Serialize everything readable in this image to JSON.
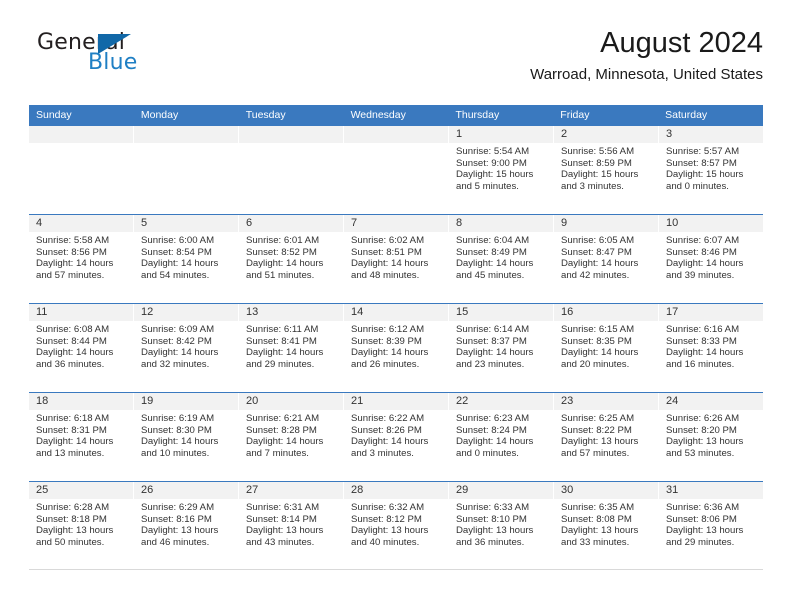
{
  "brand": {
    "name_part1": "General",
    "name_part2": "Blue",
    "triangle_color": "#1168a8",
    "blue_text_color": "#1f7fc4"
  },
  "header": {
    "month_title": "August 2024",
    "location": "Warroad, Minnesota, United States"
  },
  "theme": {
    "header_blue": "#3a79bf",
    "day_band_gray": "#f2f2f2",
    "text_color": "#333333"
  },
  "weekdays": [
    "Sunday",
    "Monday",
    "Tuesday",
    "Wednesday",
    "Thursday",
    "Friday",
    "Saturday"
  ],
  "weeks": [
    [
      {
        "day": "",
        "sunrise": "",
        "sunset": "",
        "daylight_line1": "",
        "daylight_line2": ""
      },
      {
        "day": "",
        "sunrise": "",
        "sunset": "",
        "daylight_line1": "",
        "daylight_line2": ""
      },
      {
        "day": "",
        "sunrise": "",
        "sunset": "",
        "daylight_line1": "",
        "daylight_line2": ""
      },
      {
        "day": "",
        "sunrise": "",
        "sunset": "",
        "daylight_line1": "",
        "daylight_line2": ""
      },
      {
        "day": "1",
        "sunrise": "Sunrise: 5:54 AM",
        "sunset": "Sunset: 9:00 PM",
        "daylight_line1": "Daylight: 15 hours",
        "daylight_line2": "and 5 minutes."
      },
      {
        "day": "2",
        "sunrise": "Sunrise: 5:56 AM",
        "sunset": "Sunset: 8:59 PM",
        "daylight_line1": "Daylight: 15 hours",
        "daylight_line2": "and 3 minutes."
      },
      {
        "day": "3",
        "sunrise": "Sunrise: 5:57 AM",
        "sunset": "Sunset: 8:57 PM",
        "daylight_line1": "Daylight: 15 hours",
        "daylight_line2": "and 0 minutes."
      }
    ],
    [
      {
        "day": "4",
        "sunrise": "Sunrise: 5:58 AM",
        "sunset": "Sunset: 8:56 PM",
        "daylight_line1": "Daylight: 14 hours",
        "daylight_line2": "and 57 minutes."
      },
      {
        "day": "5",
        "sunrise": "Sunrise: 6:00 AM",
        "sunset": "Sunset: 8:54 PM",
        "daylight_line1": "Daylight: 14 hours",
        "daylight_line2": "and 54 minutes."
      },
      {
        "day": "6",
        "sunrise": "Sunrise: 6:01 AM",
        "sunset": "Sunset: 8:52 PM",
        "daylight_line1": "Daylight: 14 hours",
        "daylight_line2": "and 51 minutes."
      },
      {
        "day": "7",
        "sunrise": "Sunrise: 6:02 AM",
        "sunset": "Sunset: 8:51 PM",
        "daylight_line1": "Daylight: 14 hours",
        "daylight_line2": "and 48 minutes."
      },
      {
        "day": "8",
        "sunrise": "Sunrise: 6:04 AM",
        "sunset": "Sunset: 8:49 PM",
        "daylight_line1": "Daylight: 14 hours",
        "daylight_line2": "and 45 minutes."
      },
      {
        "day": "9",
        "sunrise": "Sunrise: 6:05 AM",
        "sunset": "Sunset: 8:47 PM",
        "daylight_line1": "Daylight: 14 hours",
        "daylight_line2": "and 42 minutes."
      },
      {
        "day": "10",
        "sunrise": "Sunrise: 6:07 AM",
        "sunset": "Sunset: 8:46 PM",
        "daylight_line1": "Daylight: 14 hours",
        "daylight_line2": "and 39 minutes."
      }
    ],
    [
      {
        "day": "11",
        "sunrise": "Sunrise: 6:08 AM",
        "sunset": "Sunset: 8:44 PM",
        "daylight_line1": "Daylight: 14 hours",
        "daylight_line2": "and 36 minutes."
      },
      {
        "day": "12",
        "sunrise": "Sunrise: 6:09 AM",
        "sunset": "Sunset: 8:42 PM",
        "daylight_line1": "Daylight: 14 hours",
        "daylight_line2": "and 32 minutes."
      },
      {
        "day": "13",
        "sunrise": "Sunrise: 6:11 AM",
        "sunset": "Sunset: 8:41 PM",
        "daylight_line1": "Daylight: 14 hours",
        "daylight_line2": "and 29 minutes."
      },
      {
        "day": "14",
        "sunrise": "Sunrise: 6:12 AM",
        "sunset": "Sunset: 8:39 PM",
        "daylight_line1": "Daylight: 14 hours",
        "daylight_line2": "and 26 minutes."
      },
      {
        "day": "15",
        "sunrise": "Sunrise: 6:14 AM",
        "sunset": "Sunset: 8:37 PM",
        "daylight_line1": "Daylight: 14 hours",
        "daylight_line2": "and 23 minutes."
      },
      {
        "day": "16",
        "sunrise": "Sunrise: 6:15 AM",
        "sunset": "Sunset: 8:35 PM",
        "daylight_line1": "Daylight: 14 hours",
        "daylight_line2": "and 20 minutes."
      },
      {
        "day": "17",
        "sunrise": "Sunrise: 6:16 AM",
        "sunset": "Sunset: 8:33 PM",
        "daylight_line1": "Daylight: 14 hours",
        "daylight_line2": "and 16 minutes."
      }
    ],
    [
      {
        "day": "18",
        "sunrise": "Sunrise: 6:18 AM",
        "sunset": "Sunset: 8:31 PM",
        "daylight_line1": "Daylight: 14 hours",
        "daylight_line2": "and 13 minutes."
      },
      {
        "day": "19",
        "sunrise": "Sunrise: 6:19 AM",
        "sunset": "Sunset: 8:30 PM",
        "daylight_line1": "Daylight: 14 hours",
        "daylight_line2": "and 10 minutes."
      },
      {
        "day": "20",
        "sunrise": "Sunrise: 6:21 AM",
        "sunset": "Sunset: 8:28 PM",
        "daylight_line1": "Daylight: 14 hours",
        "daylight_line2": "and 7 minutes."
      },
      {
        "day": "21",
        "sunrise": "Sunrise: 6:22 AM",
        "sunset": "Sunset: 8:26 PM",
        "daylight_line1": "Daylight: 14 hours",
        "daylight_line2": "and 3 minutes."
      },
      {
        "day": "22",
        "sunrise": "Sunrise: 6:23 AM",
        "sunset": "Sunset: 8:24 PM",
        "daylight_line1": "Daylight: 14 hours",
        "daylight_line2": "and 0 minutes."
      },
      {
        "day": "23",
        "sunrise": "Sunrise: 6:25 AM",
        "sunset": "Sunset: 8:22 PM",
        "daylight_line1": "Daylight: 13 hours",
        "daylight_line2": "and 57 minutes."
      },
      {
        "day": "24",
        "sunrise": "Sunrise: 6:26 AM",
        "sunset": "Sunset: 8:20 PM",
        "daylight_line1": "Daylight: 13 hours",
        "daylight_line2": "and 53 minutes."
      }
    ],
    [
      {
        "day": "25",
        "sunrise": "Sunrise: 6:28 AM",
        "sunset": "Sunset: 8:18 PM",
        "daylight_line1": "Daylight: 13 hours",
        "daylight_line2": "and 50 minutes."
      },
      {
        "day": "26",
        "sunrise": "Sunrise: 6:29 AM",
        "sunset": "Sunset: 8:16 PM",
        "daylight_line1": "Daylight: 13 hours",
        "daylight_line2": "and 46 minutes."
      },
      {
        "day": "27",
        "sunrise": "Sunrise: 6:31 AM",
        "sunset": "Sunset: 8:14 PM",
        "daylight_line1": "Daylight: 13 hours",
        "daylight_line2": "and 43 minutes."
      },
      {
        "day": "28",
        "sunrise": "Sunrise: 6:32 AM",
        "sunset": "Sunset: 8:12 PM",
        "daylight_line1": "Daylight: 13 hours",
        "daylight_line2": "and 40 minutes."
      },
      {
        "day": "29",
        "sunrise": "Sunrise: 6:33 AM",
        "sunset": "Sunset: 8:10 PM",
        "daylight_line1": "Daylight: 13 hours",
        "daylight_line2": "and 36 minutes."
      },
      {
        "day": "30",
        "sunrise": "Sunrise: 6:35 AM",
        "sunset": "Sunset: 8:08 PM",
        "daylight_line1": "Daylight: 13 hours",
        "daylight_line2": "and 33 minutes."
      },
      {
        "day": "31",
        "sunrise": "Sunrise: 6:36 AM",
        "sunset": "Sunset: 8:06 PM",
        "daylight_line1": "Daylight: 13 hours",
        "daylight_line2": "and 29 minutes."
      }
    ]
  ]
}
